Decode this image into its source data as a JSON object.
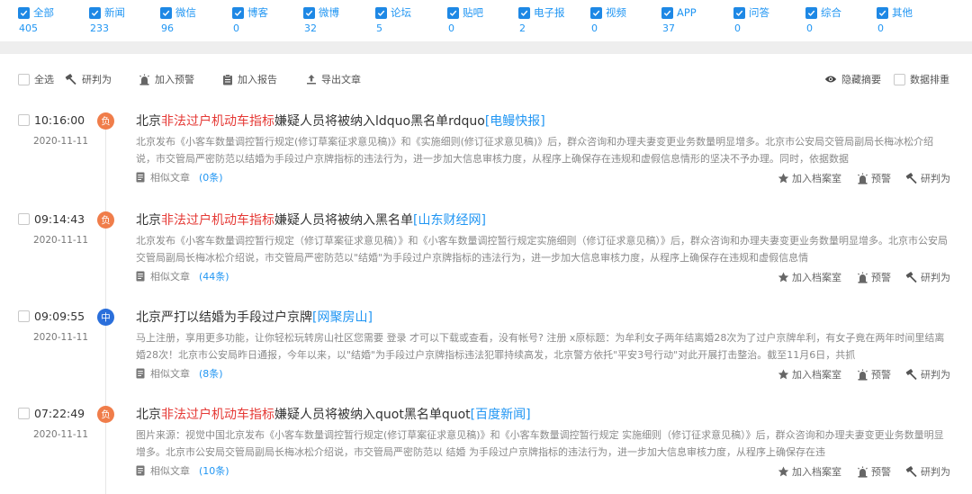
{
  "filters": [
    {
      "label": "全部",
      "count": "405"
    },
    {
      "label": "新闻",
      "count": "233"
    },
    {
      "label": "微信",
      "count": "96"
    },
    {
      "label": "博客",
      "count": "0"
    },
    {
      "label": "微博",
      "count": "32"
    },
    {
      "label": "论坛",
      "count": "5"
    },
    {
      "label": "贴吧",
      "count": "0"
    },
    {
      "label": "电子报",
      "count": "2"
    },
    {
      "label": "视频",
      "count": "0"
    },
    {
      "label": "APP",
      "count": "37"
    },
    {
      "label": "问答",
      "count": "0"
    },
    {
      "label": "综合",
      "count": "0"
    },
    {
      "label": "其他",
      "count": "0"
    }
  ],
  "toolbar": {
    "select_all": "全选",
    "judge": "研判为",
    "add_alert": "加入预警",
    "add_report": "加入报告",
    "export": "导出文章",
    "hide_summary": "隐藏摘要",
    "dedupe": "数据排重"
  },
  "actions": {
    "archive": "加入档案室",
    "alert": "预警",
    "judge": "研判为",
    "similar": "相似文章"
  },
  "articles": [
    {
      "time": "10:16:00",
      "date": "2020-11-11",
      "badge": "负",
      "title_pre": "北京",
      "title_hl": "非法过户机动车指标",
      "title_post": "嫌疑人员将被纳入ldquo黑名单rdquo",
      "source": "[电鳗快报]",
      "snippet": "北京发布《小客车数量调控暂行规定(修订草案征求意见稿)》和《实施细则(修订征求意见稿)》后，群众咨询和办理夫妻变更业务数量明显增多。北京市公安局交管局副局长梅冰松介绍说，市交管局严密防范以结婚为手段过户京牌指标的违法行为，进一步加大信息审核力度，从程序上确保存在违规和虚假信息情形的坚决不予办理。同时，依据数据",
      "similar_count": "(0条)"
    },
    {
      "time": "09:14:43",
      "date": "2020-11-11",
      "badge": "负",
      "title_pre": "北京",
      "title_hl": "非法过户机动车指标",
      "title_post": "嫌疑人员将被纳入黑名单",
      "source": "[山东财经网]",
      "snippet": "北京发布《小客车数量调控暂行规定（修订草案征求意见稿）》和《小客车数量调控暂行规定实施细则（修订征求意见稿）》后，群众咨询和办理夫妻变更业务数量明显增多。北京市公安局交管局副局长梅冰松介绍说，市交管局严密防范以\"结婚\"为手段过户京牌指标的违法行为，进一步加大信息审核力度，从程序上确保存在违规和虚假信息情",
      "similar_count": "(44条)"
    },
    {
      "time": "09:09:55",
      "date": "2020-11-11",
      "badge": "中",
      "title_pre": "北京严打以结婚为手段过户京牌",
      "title_hl": "",
      "title_post": "",
      "source": "[网聚房山]",
      "snippet": "马上注册，享用更多功能，让你轻松玩转房山社区您需要 登录 才可以下载或查看，没有帐号? 注册 x原标题：为牟利女子两年结离婚28次为了过户京牌牟利，有女子竟在两年时间里结离婚28次！北京市公安局昨日通报，今年以来，以\"结婚\"为手段过户京牌指标违法犯罪持续高发，北京警方依托\"平安3号行动\"对此开展打击整治。截至11月6日，共抓",
      "similar_count": "(8条)"
    },
    {
      "time": "07:22:49",
      "date": "2020-11-11",
      "badge": "负",
      "title_pre": "北京",
      "title_hl": "非法过户机动车指标",
      "title_post": "嫌疑人员将被纳入quot黑名单quot",
      "source": "[百度新闻]",
      "snippet": "图片来源：视觉中国北京发布《小客车数量调控暂行规定(修订草案征求意见稿)》和《小客车数量调控暂行规定 实施细则（修订征求意见稿）》后，群众咨询和办理夫妻变更业务数量明显增多。北京市公安局交管局副局长梅冰松介绍说，市交管局严密防范以 结婚 为手段过户京牌指标的违法行为，进一步加大信息审核力度，从程序上确保存在违",
      "similar_count": "(10条)"
    }
  ]
}
